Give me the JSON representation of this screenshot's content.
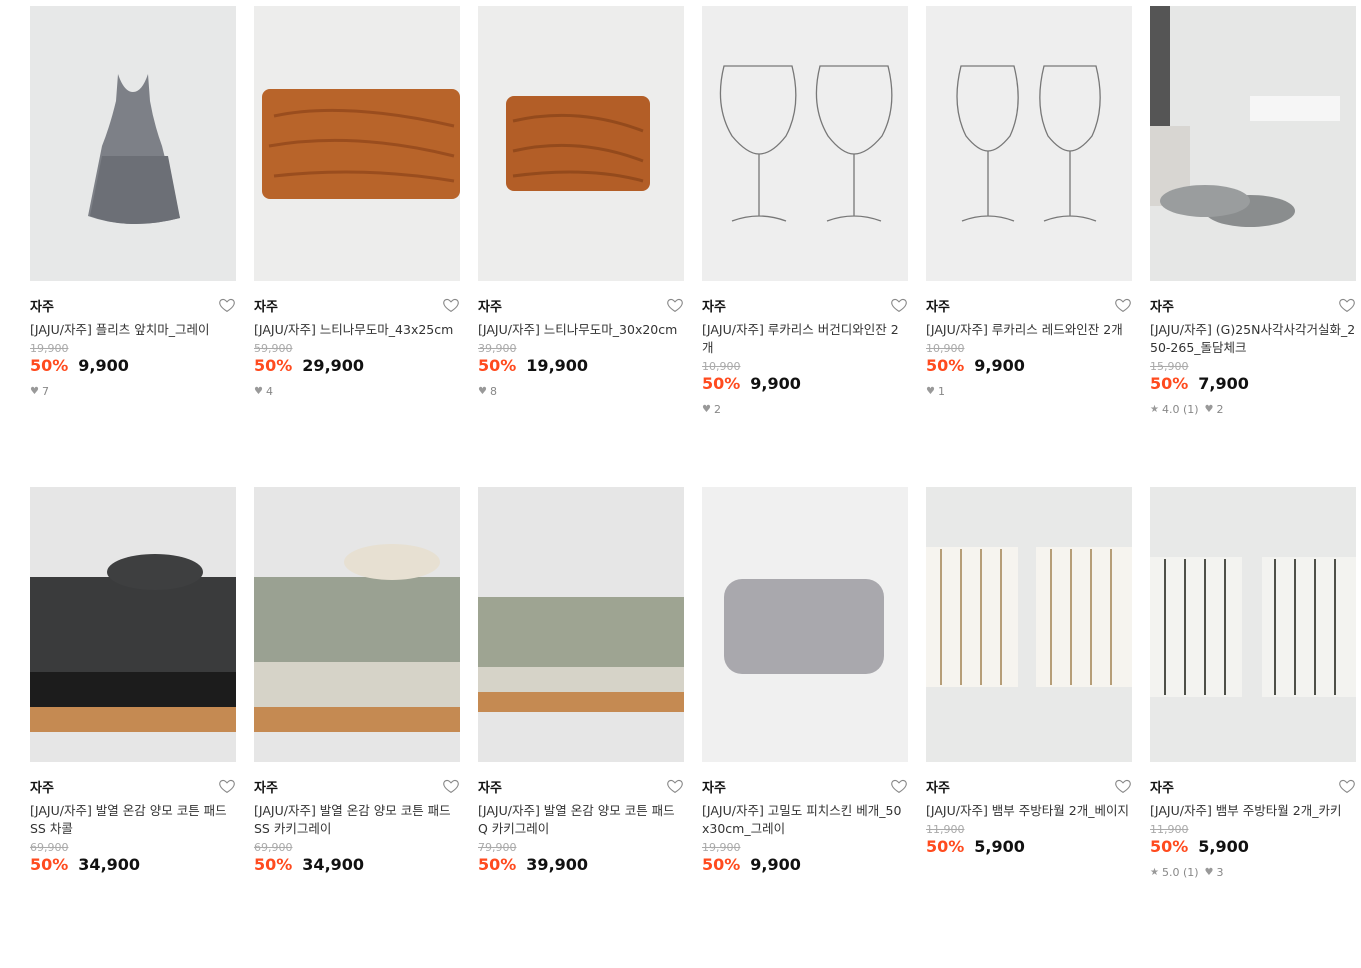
{
  "products": [
    {
      "brand": "자주",
      "name": "[JAJU/자주] 플리츠 앞치마_그레이",
      "original_price": "19,900",
      "discount": "50%",
      "price": "9,900",
      "rating": "",
      "likes": "7",
      "image": "apron"
    },
    {
      "brand": "자주",
      "name": "[JAJU/자주] 느티나무도마_43x25cm",
      "original_price": "59,900",
      "discount": "50%",
      "price": "29,900",
      "rating": "",
      "likes": "4",
      "image": "board-large"
    },
    {
      "brand": "자주",
      "name": "[JAJU/자주] 느티나무도마_30x20cm",
      "original_price": "39,900",
      "discount": "50%",
      "price": "19,900",
      "rating": "",
      "likes": "8",
      "image": "board-small"
    },
    {
      "brand": "자주",
      "name": "[JAJU/자주] 루카리스 버건디와인잔 2개",
      "original_price": "10,900",
      "discount": "50%",
      "price": "9,900",
      "rating": "",
      "likes": "2",
      "image": "wine-burgundy"
    },
    {
      "brand": "자주",
      "name": "[JAJU/자주] 루카리스 레드와인잔 2개",
      "original_price": "10,900",
      "discount": "50%",
      "price": "9,900",
      "rating": "",
      "likes": "1",
      "image": "wine-red"
    },
    {
      "brand": "자주",
      "name": "[JAJU/자주] (G)25N사각사각거실화_250-265_돌담체크",
      "original_price": "15,900",
      "discount": "50%",
      "price": "7,900",
      "rating": "4.0 (1)",
      "likes": "2",
      "image": "slippers"
    },
    {
      "brand": "자주",
      "name": "[JAJU/자주] 발열 온감 양모 코튼 패드 SS 차콜",
      "original_price": "69,900",
      "discount": "50%",
      "price": "34,900",
      "rating": "",
      "likes": "",
      "image": "pad-charcoal"
    },
    {
      "brand": "자주",
      "name": "[JAJU/자주] 발열 온감 양모 코튼 패드 SS 카키그레이",
      "original_price": "69,900",
      "discount": "50%",
      "price": "34,900",
      "rating": "",
      "likes": "",
      "image": "pad-khaki"
    },
    {
      "brand": "자주",
      "name": "[JAJU/자주] 발열 온감 양모 코튼 패드 Q 카키그레이",
      "original_price": "79,900",
      "discount": "50%",
      "price": "39,900",
      "rating": "",
      "likes": "",
      "image": "pad-khaki-q"
    },
    {
      "brand": "자주",
      "name": "[JAJU/자주] 고밀도 피치스킨 베개_50x30cm_그레이",
      "original_price": "19,900",
      "discount": "50%",
      "price": "9,900",
      "rating": "",
      "likes": "",
      "image": "pillow"
    },
    {
      "brand": "자주",
      "name": "[JAJU/자주] 뱀부 주방타월 2개_베이지",
      "original_price": "11,900",
      "discount": "50%",
      "price": "5,900",
      "rating": "",
      "likes": "",
      "image": "towel-beige"
    },
    {
      "brand": "자주",
      "name": "[JAJU/자주] 뱀부 주방타월 2개_카키",
      "original_price": "11,900",
      "discount": "50%",
      "price": "5,900",
      "rating": "5.0 (1)",
      "likes": "3",
      "image": "towel-khaki"
    }
  ],
  "colors": {
    "discount": "#ff4b1f",
    "brand": "#111111",
    "strike": "#aaaaaa"
  },
  "icons": {
    "wishlist": "heart-outline-icon",
    "like": "heart-filled-icon",
    "rating": "star-icon"
  }
}
